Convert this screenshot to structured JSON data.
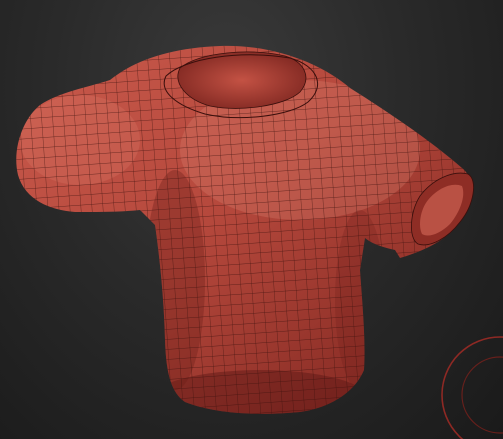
{
  "viewport": {
    "background": "#1c1c1c",
    "model": {
      "name": "t-shirt",
      "shading_color": "#b5483c",
      "highlight_color": "#d9786a",
      "shadow_color": "#6a1d18",
      "wireframe_color": "#3a0f0c",
      "polyframe": true
    },
    "gizmo": {
      "icon": "rotation-circle-icon",
      "color": "#9a2a25"
    }
  }
}
